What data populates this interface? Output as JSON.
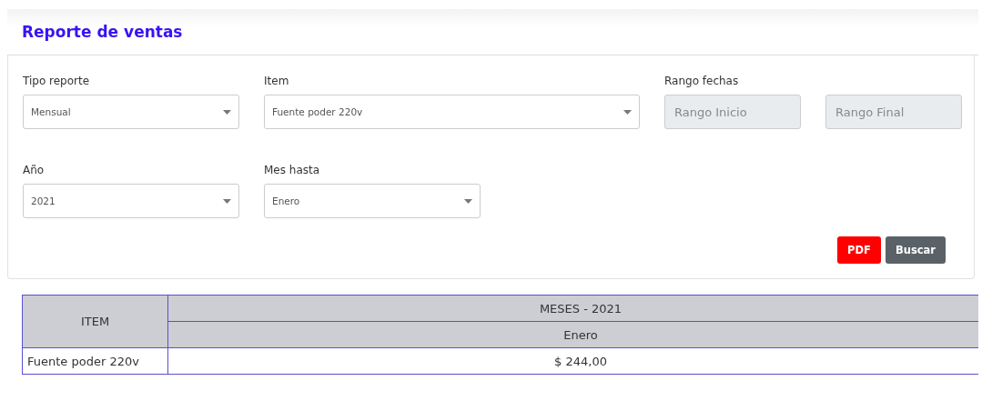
{
  "header": {
    "title": "Reporte de ventas"
  },
  "filter_rows": [
    [
      {
        "kind": "select",
        "label": "Tipo reporte",
        "value": "Mensual"
      },
      {
        "kind": "select",
        "label": "Item",
        "value": "Fuente poder 220v"
      },
      {
        "kind": "range",
        "label": "Rango fechas",
        "fields": [
          {
            "placeholder": "Rango Inicio"
          },
          {
            "placeholder": "Rango Final"
          }
        ]
      }
    ],
    [
      {
        "kind": "select",
        "label": "Año",
        "value": "2021"
      },
      {
        "kind": "select",
        "label": "Mes hasta",
        "value": "Enero"
      }
    ]
  ],
  "buttons": [
    {
      "label": "PDF",
      "kind": "danger"
    },
    {
      "label": "Buscar",
      "kind": "secondary"
    }
  ],
  "table": {
    "item_header": "ITEM",
    "group_header": "MESES - 2021",
    "months": [
      "Enero"
    ],
    "rows": [
      {
        "item": "Fuente poder 220v",
        "values": [
          "$ 244,00"
        ]
      }
    ]
  }
}
